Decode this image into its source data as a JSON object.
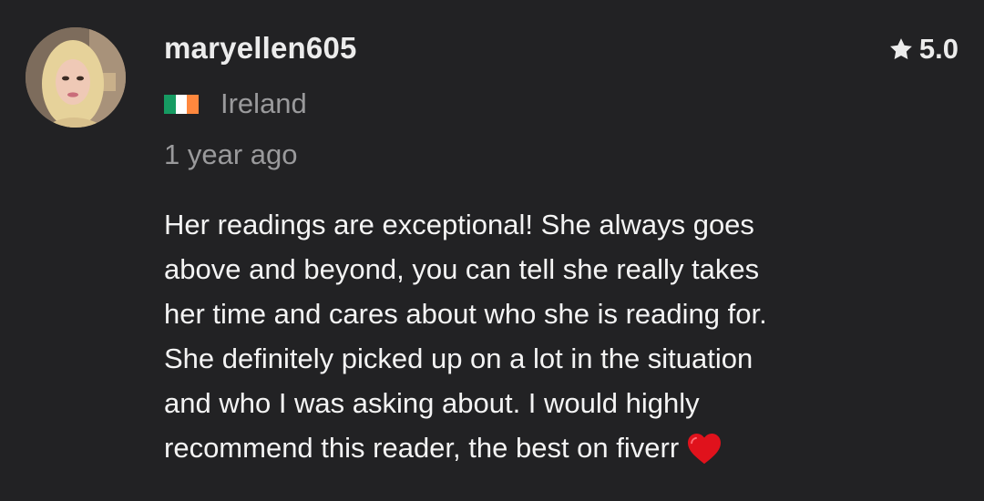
{
  "review": {
    "username": "maryellen605",
    "rating": "5.0",
    "rating_icon": "star-icon",
    "country": "Ireland",
    "country_flag": "ireland-flag-icon",
    "flag_colors": [
      "#169b62",
      "#ffffff",
      "#ff883e"
    ],
    "time_ago": "1 year ago",
    "body_lines": [
      "Her readings are exceptional! She always goes",
      "above and beyond, you can tell she really takes",
      "her time and cares about who she is reading for.",
      "She definitely picked up on a lot in the situation",
      "and who I was asking about. I would highly",
      "recommend this reader, the best on fiverr"
    ],
    "end_emoji": "red-heart-icon"
  },
  "colors": {
    "background": "#222224",
    "primary_text": "#f4f4f4",
    "secondary_text": "#9a9a9c",
    "heart": "#e0121c"
  }
}
